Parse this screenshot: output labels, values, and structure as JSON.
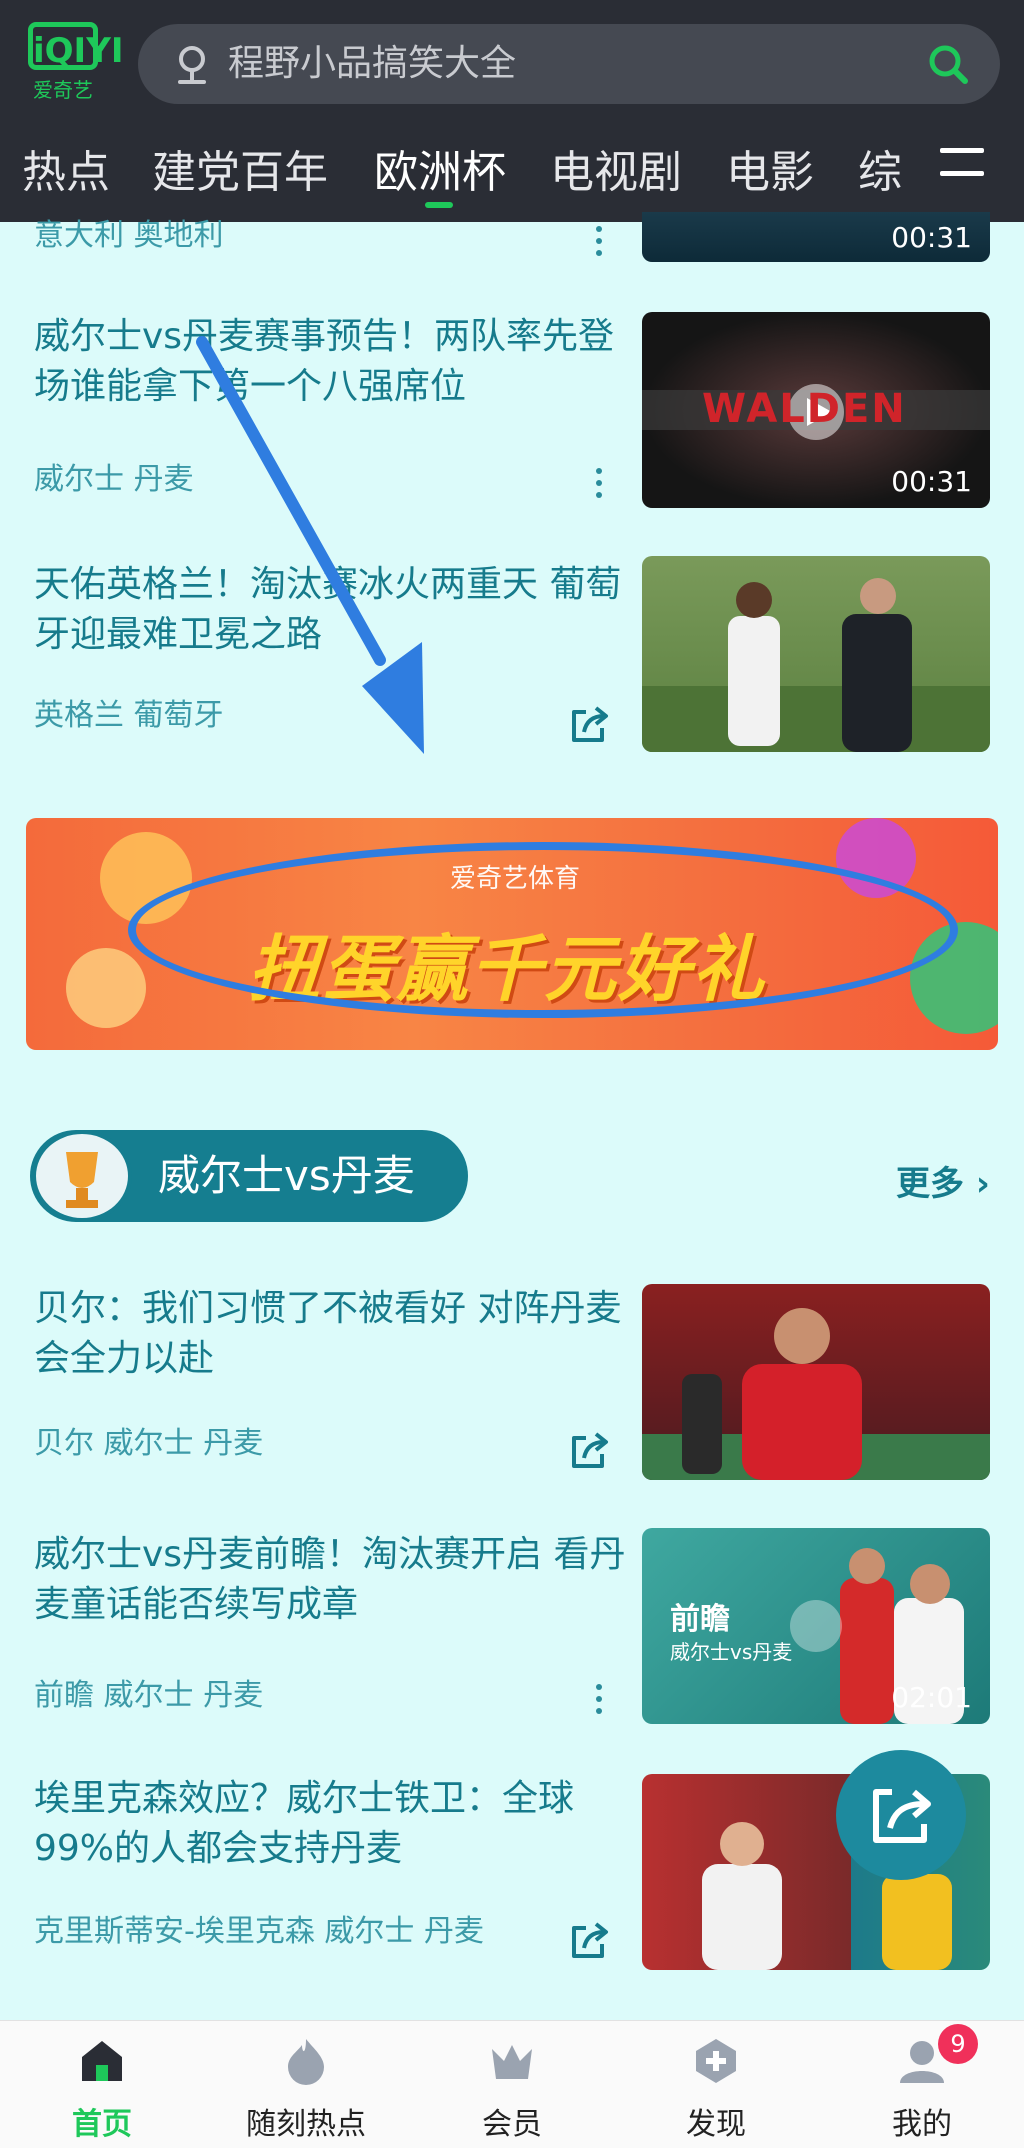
{
  "app": {
    "logo_text": "iQIYI",
    "logo_sub": "爱奇艺"
  },
  "search": {
    "placeholder": "程野小品搞笑大全"
  },
  "tabs": [
    {
      "label": "热点"
    },
    {
      "label": "建党百年"
    },
    {
      "label": "欧洲杯"
    },
    {
      "label": "电视剧"
    },
    {
      "label": "电影"
    },
    {
      "label": "综"
    }
  ],
  "active_tab": "欧洲杯",
  "top_partial": {
    "tags": "意大利 奥地利",
    "duration": "00:31"
  },
  "items": [
    {
      "title": "威尔士vs丹麦赛事预告！两队率先登场谁能拿下第一个八强席位",
      "tags": "威尔士 丹麦",
      "duration": "00:31",
      "thumb_text": "WALDEN"
    },
    {
      "title": "天佑英格兰！淘汰赛冰火两重天 葡萄牙迎最难卫冕之路",
      "tags": "英格兰 葡萄牙"
    }
  ],
  "banner": {
    "subtitle": "爱奇艺体育",
    "main": "扭蛋赢千元好礼"
  },
  "section": {
    "title": "威尔士vs丹麦",
    "more": "更多"
  },
  "section_items": [
    {
      "title": "贝尔：我们习惯了不被看好 对阵丹麦会全力以赴",
      "tags": "贝尔 威尔士 丹麦"
    },
    {
      "title": "威尔士vs丹麦前瞻！淘汰赛开启 看丹麦童话能否续写成章",
      "tags": "前瞻 威尔士 丹麦",
      "duration": "02:01",
      "thumb_big": "前瞻",
      "thumb_small": "威尔士vs丹麦"
    },
    {
      "title": "埃里克森效应？威尔士铁卫：全球99%的人都会支持丹麦",
      "tags": "克里斯蒂安-埃里克森 威尔士 丹麦"
    }
  ],
  "bottom_nav": [
    {
      "label": "首页",
      "icon": "home-icon"
    },
    {
      "label": "随刻热点",
      "icon": "flame-icon"
    },
    {
      "label": "会员",
      "icon": "crown-icon"
    },
    {
      "label": "发现",
      "icon": "discover-icon"
    },
    {
      "label": "我的",
      "icon": "profile-icon"
    }
  ],
  "profile_badge": "9",
  "colors": {
    "header_bg": "#2a2d35",
    "accent_green": "#1ec85a",
    "feed_bg": "#dcfbfa",
    "title_teal": "#167b8c",
    "annotation_blue": "#2f7de0"
  }
}
